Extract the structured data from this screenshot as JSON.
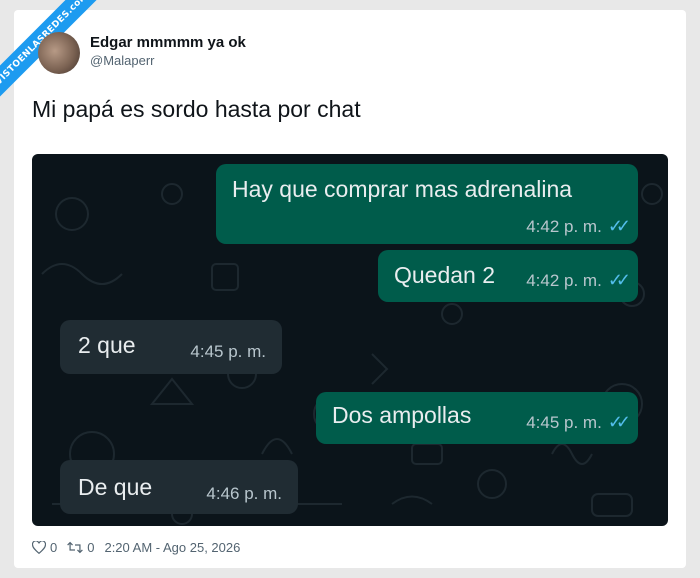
{
  "watermark": "VISTOENLASREDES.com",
  "author": {
    "name": "Edgar mmmmm ya ok",
    "handle": "@Malaperr"
  },
  "tweet_text": "Mi papá es sordo hasta por chat",
  "chat": {
    "messages": [
      {
        "direction": "out",
        "text": "Hay que comprar mas adrenalina",
        "time": "4:42 p. m.",
        "read": true
      },
      {
        "direction": "out",
        "text": "Quedan 2",
        "time": "4:42 p. m.",
        "read": true
      },
      {
        "direction": "in",
        "text": "2 que",
        "time": "4:45 p. m."
      },
      {
        "direction": "out",
        "text": "Dos ampollas",
        "time": "4:45 p. m.",
        "read": true
      },
      {
        "direction": "in",
        "text": "De que",
        "time": "4:46 p. m."
      }
    ],
    "colors": {
      "background": "#0b141a",
      "outgoing": "#005c4b",
      "incoming": "#202c33",
      "read_ticks": "#53bdeb"
    }
  },
  "footer": {
    "likes": "0",
    "retweets": "0",
    "timestamp": "2:20 AM - Ago 25, 2026"
  }
}
